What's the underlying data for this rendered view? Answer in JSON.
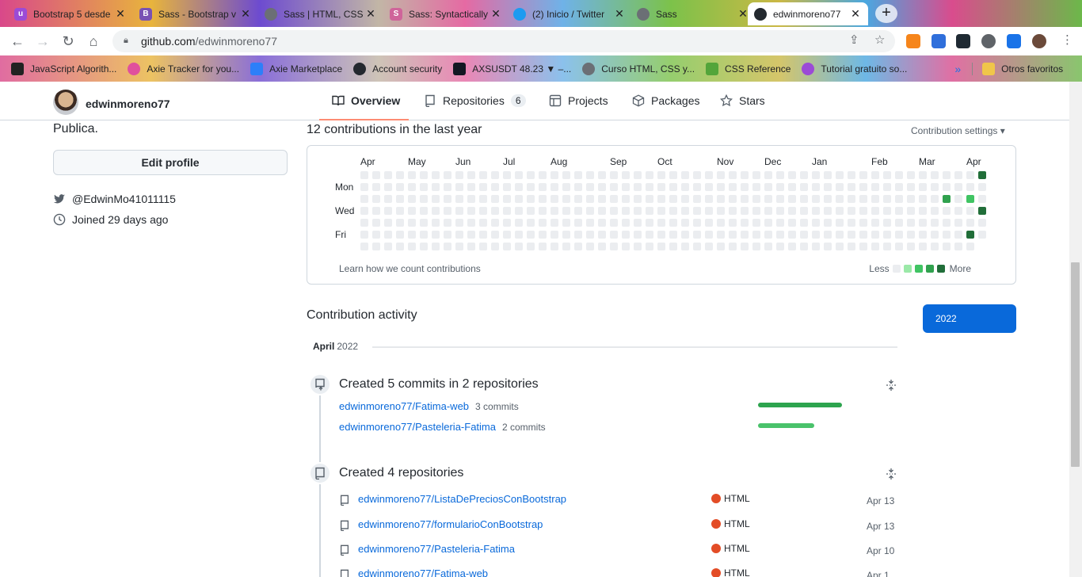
{
  "browser": {
    "tabs": [
      {
        "title": "Bootstrap 5 desde",
        "fav_color": "#9b4bd6",
        "fav_glyph": "u"
      },
      {
        "title": "Sass - Bootstrap v",
        "fav_color": "#7952b3",
        "fav_glyph": "B"
      },
      {
        "title": "Sass | HTML, CSS",
        "fav_color": "#6b6f75",
        "fav_glyph": ""
      },
      {
        "title": "Sass: Syntactically",
        "fav_color": "#cf649a",
        "fav_glyph": "S"
      },
      {
        "title": "(2) Inicio / Twitter",
        "fav_color": "#1d9bf0",
        "fav_glyph": ""
      },
      {
        "title": "Sass",
        "fav_color": "#6b6f75",
        "fav_glyph": ""
      },
      {
        "title": "edwinmoreno77",
        "fav_color": "#24292f",
        "fav_glyph": ""
      }
    ],
    "new_tab": "+",
    "close_glyph": "✕",
    "url_host": "github.com",
    "url_path": "/edwinmoreno77",
    "bookmarks": [
      {
        "label": "JavaScript Algorith...",
        "color": "#222"
      },
      {
        "label": "Axie Tracker for you...",
        "color": "#e0509d"
      },
      {
        "label": "Axie Marketplace",
        "color": "#2d7ff9"
      },
      {
        "label": "Account security",
        "color": "#24292f"
      },
      {
        "label": "AXSUSDT 48.23 ▼ –...",
        "color": "#131722"
      },
      {
        "label": "Curso HTML, CSS y...",
        "color": "#6b6f75"
      },
      {
        "label": "CSS Reference",
        "color": "#53a53a"
      },
      {
        "label": "Tutorial gratuito so...",
        "color": "#9b4bd6"
      }
    ],
    "bookmarks_more": "»",
    "other_bookmarks": "Otros favoritos"
  },
  "profile": {
    "username": "edwinmoreno77",
    "bio": "Publica.",
    "edit_button": "Edit profile",
    "twitter": "@EdwinMo41011115",
    "joined": "Joined 29 days ago"
  },
  "nav": {
    "overview": "Overview",
    "repositories": "Repositories",
    "repositories_count": "6",
    "projects": "Projects",
    "packages": "Packages",
    "stars": "Stars"
  },
  "contributions": {
    "title": "12 contributions in the last year",
    "settings": "Contribution settings ▾",
    "months": [
      "Apr",
      "May",
      "Jun",
      "Jul",
      "Aug",
      "Sep",
      "Oct",
      "Nov",
      "Dec",
      "Jan",
      "Feb",
      "Mar",
      "Apr"
    ],
    "month_week_index": [
      0,
      4,
      8,
      12,
      16,
      21,
      25,
      30,
      34,
      38,
      43,
      47,
      51
    ],
    "days": [
      "Mon",
      "Wed",
      "Fri"
    ],
    "weeks": 53,
    "active_cells": [
      {
        "week": 52,
        "day": 0,
        "level": 4
      },
      {
        "week": 49,
        "day": 2,
        "level": 3
      },
      {
        "week": 51,
        "day": 2,
        "level": 2
      },
      {
        "week": 52,
        "day": 3,
        "level": 4
      },
      {
        "week": 51,
        "day": 5,
        "level": 4
      }
    ],
    "level_colors": [
      "#ebedf0",
      "#9be9a8",
      "#40c463",
      "#30a14e",
      "#216e39"
    ],
    "learn_link": "Learn how we count contributions",
    "legend_less": "Less",
    "legend_more": "More"
  },
  "activity": {
    "title": "Contribution activity",
    "year_button": "2022",
    "month": "April",
    "year": "2022",
    "commits_title": "Created 5 commits in 2 repositories",
    "commits": [
      {
        "repo": "edwinmoreno77/Fatima-web",
        "count": "3 commits",
        "share": 1.0,
        "color": "#2da44e"
      },
      {
        "repo": "edwinmoreno77/Pasteleria-Fatima",
        "count": "2 commits",
        "share": 0.67,
        "color": "#4ac26b"
      }
    ],
    "repos_title": "Created 4 repositories",
    "repos": [
      {
        "name": "edwinmoreno77/ListaDePreciosConBootstrap",
        "lang": "HTML",
        "date": "Apr 13"
      },
      {
        "name": "edwinmoreno77/formularioConBootstrap",
        "lang": "HTML",
        "date": "Apr 13"
      },
      {
        "name": "edwinmoreno77/Pasteleria-Fatima",
        "lang": "HTML",
        "date": "Apr 10"
      },
      {
        "name": "edwinmoreno77/Fatima-web",
        "lang": "HTML",
        "date": "Apr 1"
      }
    ],
    "lang_color": "#e34c26"
  }
}
